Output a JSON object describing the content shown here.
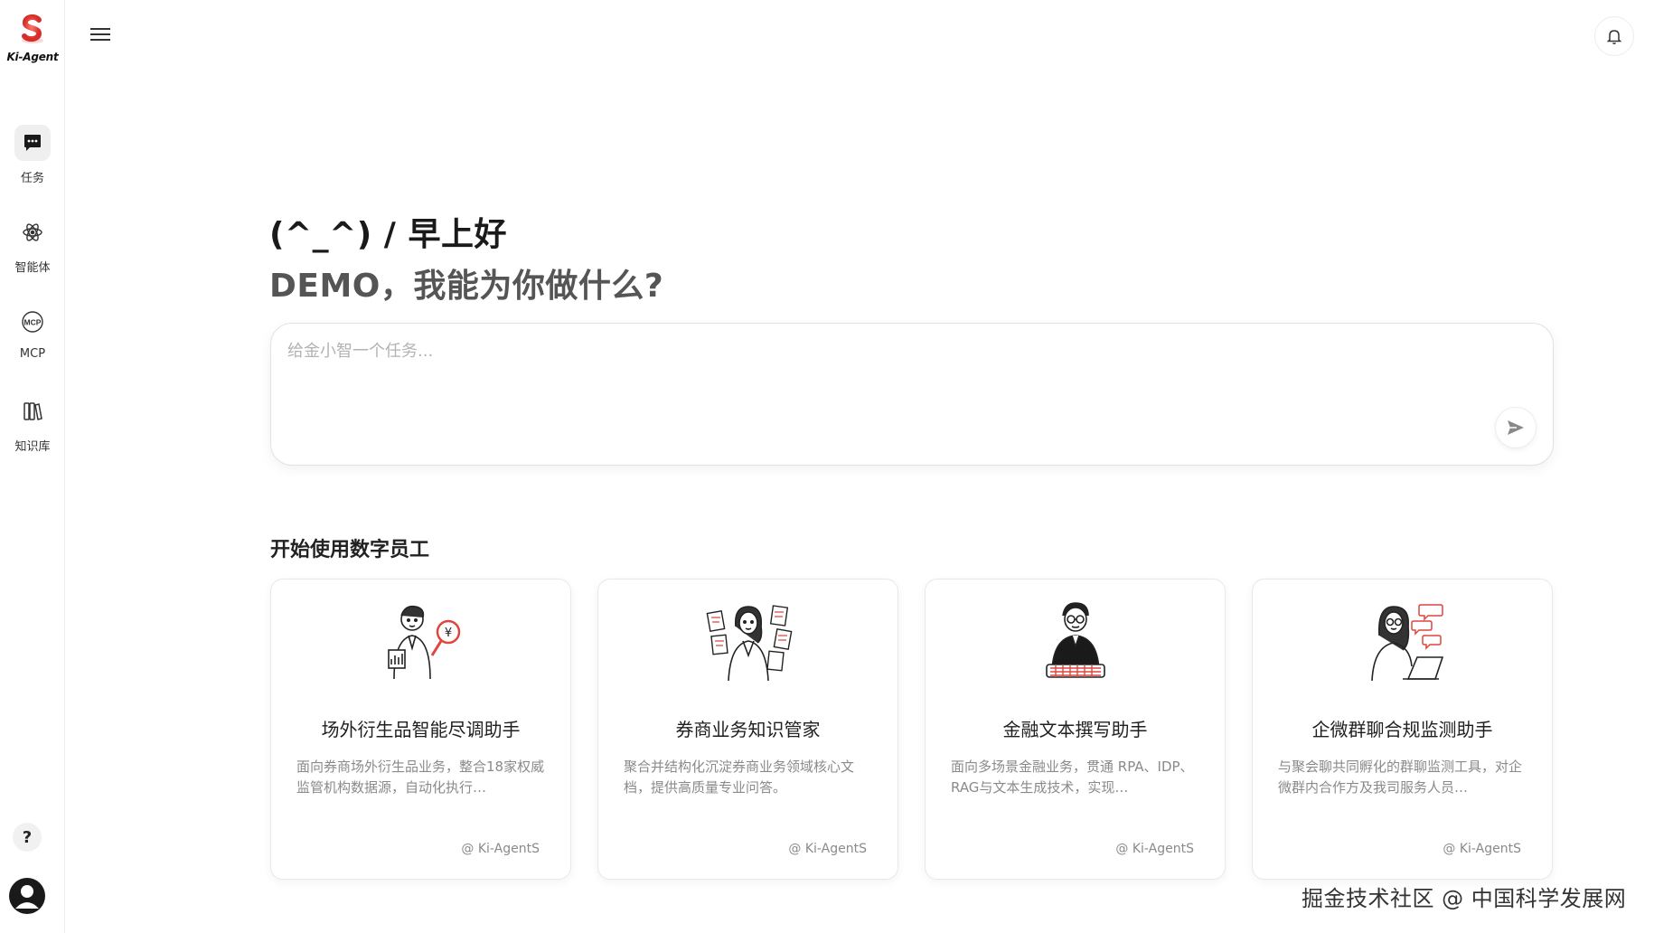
{
  "brand": {
    "name": "Ki-Agent",
    "accent": "#e0453e"
  },
  "sidebar": {
    "items": [
      {
        "label": "任务",
        "icon": "chat-bubble-icon",
        "active": true
      },
      {
        "label": "智能体",
        "icon": "atom-icon",
        "active": false
      },
      {
        "label": "MCP",
        "icon": "mcp-icon",
        "active": false
      },
      {
        "label": "知识库",
        "icon": "books-icon",
        "active": false
      }
    ],
    "help": "?"
  },
  "greeting": {
    "line1": "(^_^) / 早上好",
    "line2": "DEMO，我能为你做什么?"
  },
  "task_input": {
    "placeholder": "给金小智一个任务..."
  },
  "section": {
    "title": "开始使用数字员工"
  },
  "cards": [
    {
      "title": "场外衍生品智能尽调助手",
      "desc": "面向券商场外衍生品业务，整合18家权威监管机构数据源，自动化执行…",
      "source": "@ Ki-AgentS",
      "illustration": "analyst-illustration"
    },
    {
      "title": "券商业务知识管家",
      "desc": "聚合并结构化沉淀券商业务领域核心文档，提供高质量专业问答。",
      "source": "@ Ki-AgentS",
      "illustration": "documents-illustration"
    },
    {
      "title": "金融文本撰写助手",
      "desc": "面向多场景金融业务，贯通 RPA、IDP、RAG与文本生成技术，实现…",
      "source": "@ Ki-AgentS",
      "illustration": "writer-illustration"
    },
    {
      "title": "企微群聊合规监测助手",
      "desc": "与聚会聊共同孵化的群聊监测工具，对企微群内合作方及我司服务人员…",
      "source": "@ Ki-AgentS",
      "illustration": "chat-monitor-illustration"
    }
  ],
  "watermark": "掘金技术社区 @ 中国科学发展网"
}
